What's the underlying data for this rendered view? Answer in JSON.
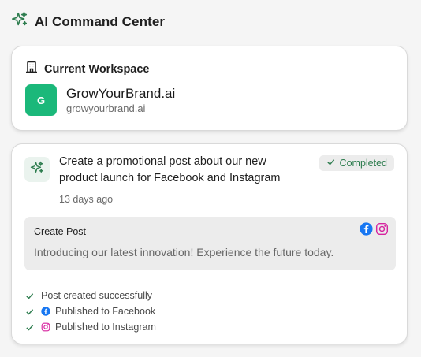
{
  "header": {
    "title": "AI Command Center",
    "icon": "sparkles-icon"
  },
  "workspace": {
    "label": "Current Workspace",
    "avatar_letter": "G",
    "avatar_color": "#1bb87a",
    "name": "GrowYourBrand.ai",
    "domain": "growyourbrand.ai"
  },
  "command": {
    "text": "Create a promotional post about our new product launch for Facebook and Instagram",
    "status": "Completed",
    "time": "13 days ago",
    "post": {
      "title": "Create Post",
      "body": "Introducing our latest innovation! Experience the future today.",
      "platforms": [
        "facebook-icon",
        "instagram-icon"
      ]
    },
    "steps": [
      {
        "label": "Post created successfully",
        "icon": ""
      },
      {
        "label": "Published to Facebook",
        "icon": "facebook-icon"
      },
      {
        "label": "Published to Instagram",
        "icon": "instagram-icon"
      }
    ]
  },
  "colors": {
    "accent": "#2e7d4f",
    "facebook": "#1877f2",
    "instagram": "#d6249f"
  }
}
